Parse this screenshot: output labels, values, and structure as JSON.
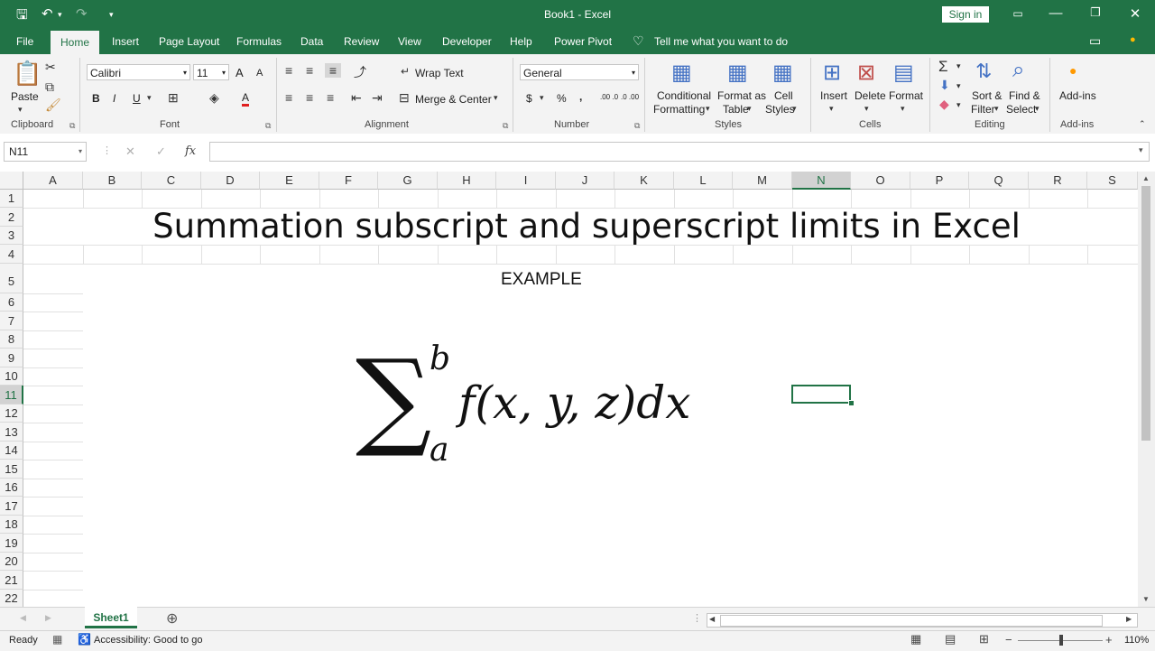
{
  "window": {
    "title": "Book1  -  Excel",
    "sign_in": "Sign in"
  },
  "ribbon_tabs": [
    "File",
    "Home",
    "Insert",
    "Page Layout",
    "Formulas",
    "Data",
    "Review",
    "View",
    "Developer",
    "Help",
    "Power Pivot"
  ],
  "tell_me": "Tell me what you want to do",
  "ribbon": {
    "clipboard": {
      "paste": "Paste",
      "label": "Clipboard"
    },
    "font": {
      "name": "Calibri",
      "size": "11",
      "label": "Font",
      "bold": "B",
      "italic": "I",
      "underline": "U",
      "grow": "A",
      "shrink": "A",
      "color": "A"
    },
    "alignment": {
      "wrap_text": "Wrap Text",
      "merge_center": "Merge & Center",
      "label": "Alignment"
    },
    "number": {
      "format": "General",
      "currency": "$",
      "percent": "%",
      "comma": ",",
      "inc_dec": ".00 .0",
      "dec_dec": ".0 .00",
      "label": "Number"
    },
    "styles": {
      "conditional": "Conditional",
      "conditional2": "Formatting",
      "format_table": "Format as",
      "format_table2": "Table",
      "cell_styles": "Cell",
      "cell_styles2": "Styles",
      "label": "Styles"
    },
    "cells": {
      "insert": "Insert",
      "delete": "Delete",
      "format": "Format",
      "label": "Cells"
    },
    "editing": {
      "sort": "Sort &",
      "sort2": "Filter",
      "find": "Find &",
      "find2": "Select",
      "label": "Editing"
    },
    "addins": {
      "addins": "Add-ins",
      "label": "Add-ins"
    }
  },
  "formula_bar": {
    "name_box": "N11",
    "fx": "fx",
    "cancel": "✕",
    "enter": "✓",
    "value": ""
  },
  "columns": [
    "A",
    "B",
    "C",
    "D",
    "E",
    "F",
    "G",
    "H",
    "I",
    "J",
    "K",
    "L",
    "M",
    "N",
    "O",
    "P",
    "Q",
    "R",
    "S"
  ],
  "rows": [
    "1",
    "2",
    "3",
    "4",
    "5",
    "6",
    "7",
    "8",
    "9",
    "10",
    "11",
    "12",
    "13",
    "14",
    "15",
    "16",
    "17",
    "18",
    "19",
    "20",
    "21",
    "22"
  ],
  "sheet": {
    "title": "Summation subscript and superscript limits in Excel",
    "example": "EXAMPLE",
    "equation": {
      "sigma": "∑",
      "upper": "b",
      "lower": "a",
      "body": "f(x, y, z)dx"
    }
  },
  "sheet_tabs": [
    "Sheet1"
  ],
  "status": {
    "ready": "Ready",
    "accessibility": "Accessibility: Good to go",
    "zoom": "110%"
  }
}
